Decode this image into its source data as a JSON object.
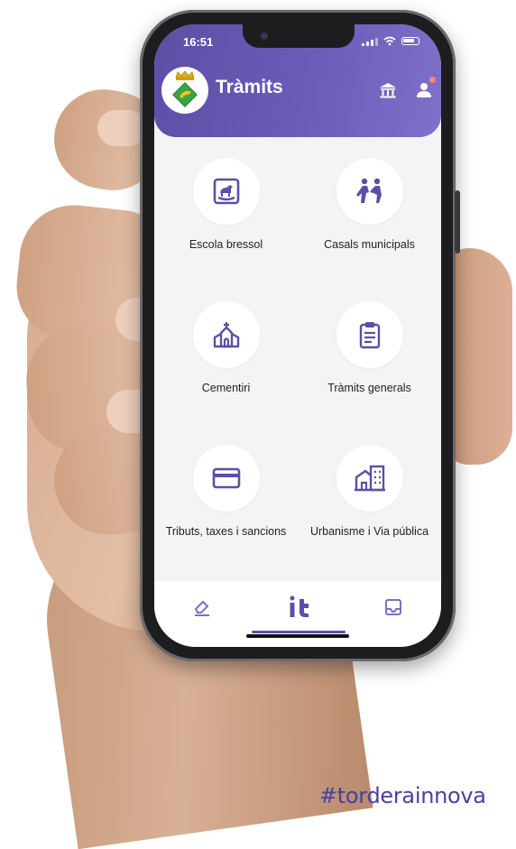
{
  "status_bar": {
    "time": "16:51"
  },
  "header": {
    "title": "Tràmits",
    "accent": "#5c4fa6"
  },
  "tiles": [
    {
      "label": "Escola bressol",
      "icon": "rocking-horse-icon"
    },
    {
      "label": "Casals municipals",
      "icon": "people-playing-icon"
    },
    {
      "label": "Cementiri",
      "icon": "chapel-icon"
    },
    {
      "label": "Tràmits generals",
      "icon": "clipboard-icon"
    },
    {
      "label": "Tributs, taxes i sancions",
      "icon": "credit-card-icon"
    },
    {
      "label": "Urbanisme i Via pública",
      "icon": "buildings-icon"
    }
  ],
  "bottom_nav": {
    "items": [
      {
        "icon": "eraser-icon"
      },
      {
        "icon": "it-logo-icon",
        "text": "it"
      },
      {
        "icon": "inbox-icon"
      }
    ],
    "active_index": 1
  },
  "hashtag": "#torderainnova"
}
